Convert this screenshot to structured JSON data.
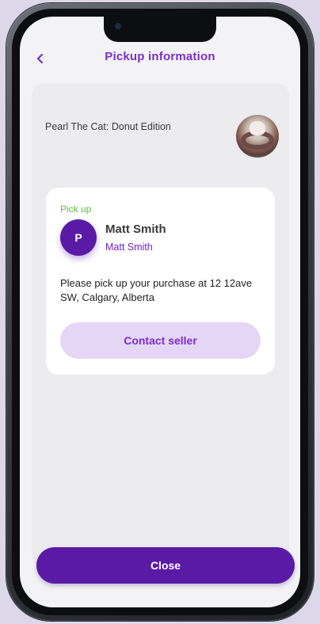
{
  "header": {
    "title": "Pickup information",
    "back_icon": "chevron-left-icon"
  },
  "item": {
    "title": "Pearl The Cat: Donut Edition"
  },
  "pickup": {
    "label": "Pick up",
    "avatar_initial": "P",
    "seller_name": "Matt Smith",
    "seller_username": "Matt Smith",
    "message": "Please pick up your purchase at 12 12ave SW, Calgary, Alberta",
    "contact_label": "Contact seller"
  },
  "footer": {
    "close_label": "Close"
  },
  "colors": {
    "accent": "#7a2fc6",
    "primary": "#5a1aa6",
    "pickup_green": "#5cbf3d",
    "contact_bg": "#e6d6f5"
  }
}
